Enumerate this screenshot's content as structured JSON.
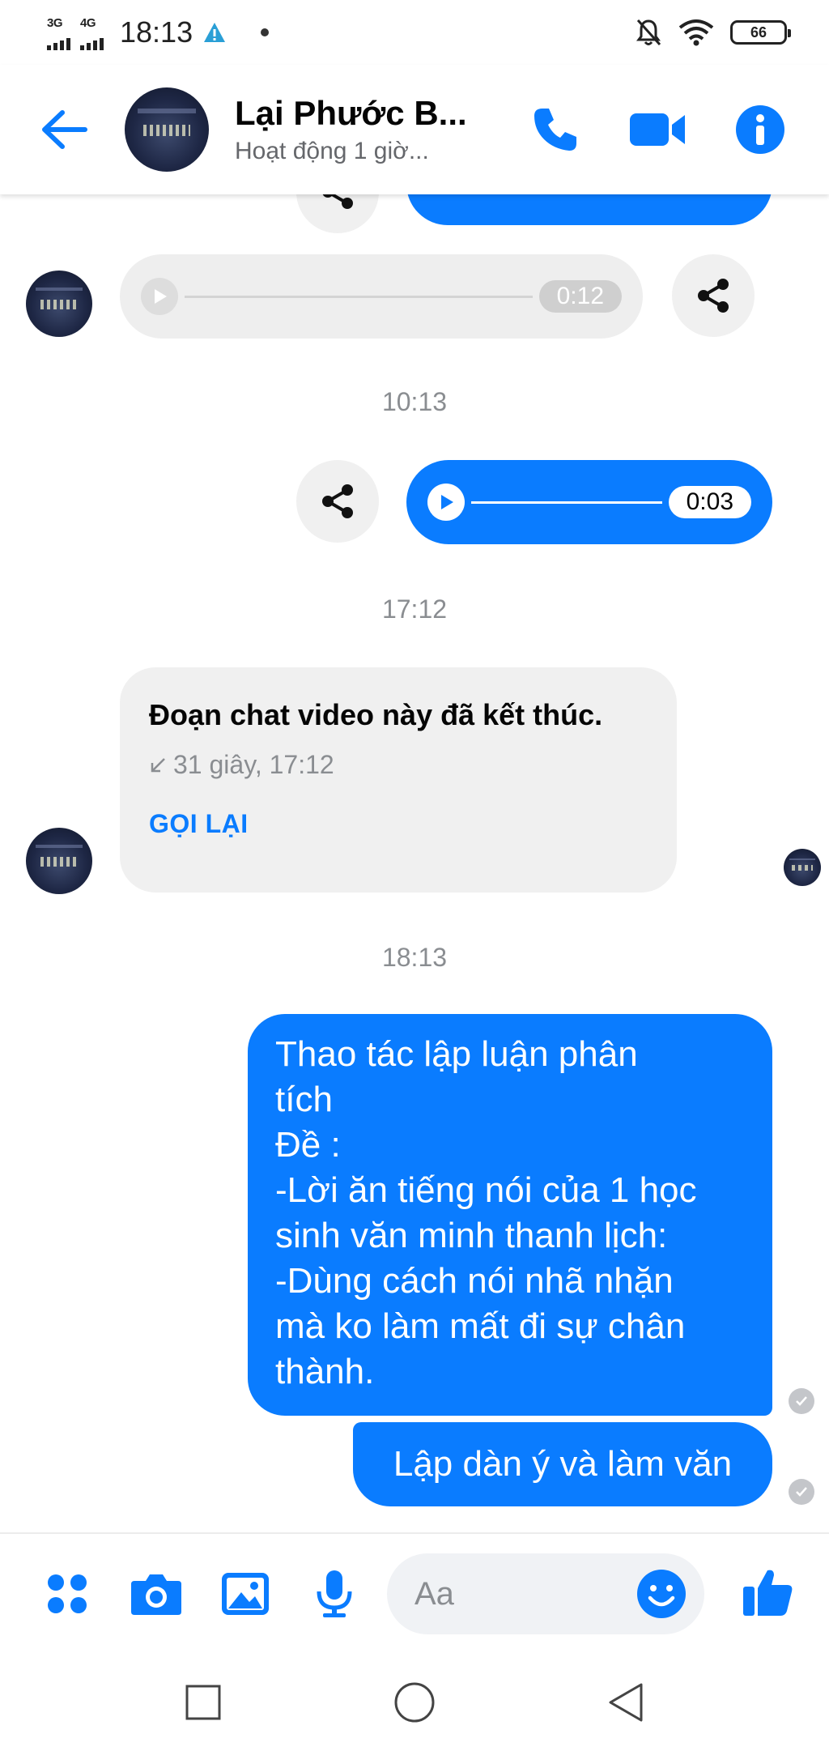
{
  "status_bar": {
    "network_1": "3G",
    "network_2": "4G",
    "time": "18:13",
    "battery": "66"
  },
  "header": {
    "contact_name": "Lại Phước B...",
    "contact_status": "Hoạt động 1 giờ..."
  },
  "messages": {
    "audio_in": {
      "duration": "0:12"
    },
    "timestamp_1": "10:13",
    "audio_out": {
      "duration": "0:03"
    },
    "timestamp_2": "17:12",
    "call_card": {
      "title": "Đoạn chat video này đã kết thúc.",
      "meta": "31 giây, 17:12",
      "action": "GỌI LẠI"
    },
    "timestamp_3": "18:13",
    "text_1_lines": [
      "Thao tác lập luận phân",
      "tích",
      "Đề :",
      "-Lời ăn tiếng nói của 1 học",
      "sinh văn minh thanh lịch:",
      "-Dùng cách nói nhã nhặn",
      "mà ko làm mất đi sự chân",
      "thành."
    ],
    "text_2": "Lập dàn ý và làm văn"
  },
  "composer": {
    "placeholder": "Aa"
  },
  "colors": {
    "accent": "#0a7cff",
    "incoming_bg": "#f0f0f0",
    "secondary_text": "#8a8d91"
  },
  "icons": [
    "back-arrow-icon",
    "phone-icon",
    "video-camera-icon",
    "info-icon",
    "share-icon",
    "play-icon",
    "apps-icon",
    "camera-icon",
    "image-icon",
    "microphone-icon",
    "emoji-icon",
    "thumbs-up-icon",
    "recent-apps-icon",
    "home-icon",
    "back-nav-icon"
  ]
}
